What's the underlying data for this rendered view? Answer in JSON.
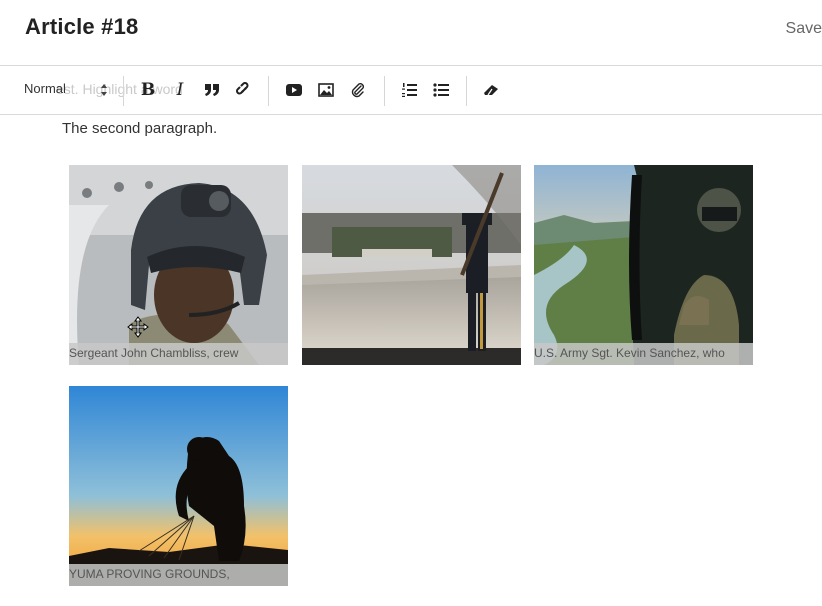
{
  "header": {
    "title": "Article #18",
    "save_label": "Save"
  },
  "toolbar": {
    "ghost_text": "est. Highlight a word",
    "block_format": {
      "selected": "Normal"
    },
    "buttons": [
      "bold-icon",
      "italic-icon",
      "quote-icon",
      "link-icon",
      "video-icon",
      "image-icon",
      "attachment-icon",
      "ordered-list-icon",
      "bullet-list-icon",
      "eraser-icon"
    ]
  },
  "content": {
    "paragraph": "The second paragraph.",
    "gallery": [
      {
        "caption": "Sergeant John Chambliss, crew",
        "alt": "soldier in flight helmet"
      },
      {
        "caption": "",
        "alt": "honor guard at memorial"
      },
      {
        "caption": "U.S. Army Sgt. Kevin Sanchez, who",
        "alt": "crew chief in helicopter over river"
      },
      {
        "caption": "YUMA PROVING GROUNDS,",
        "alt": "silhouette of paratrooper at sunset"
      }
    ]
  }
}
